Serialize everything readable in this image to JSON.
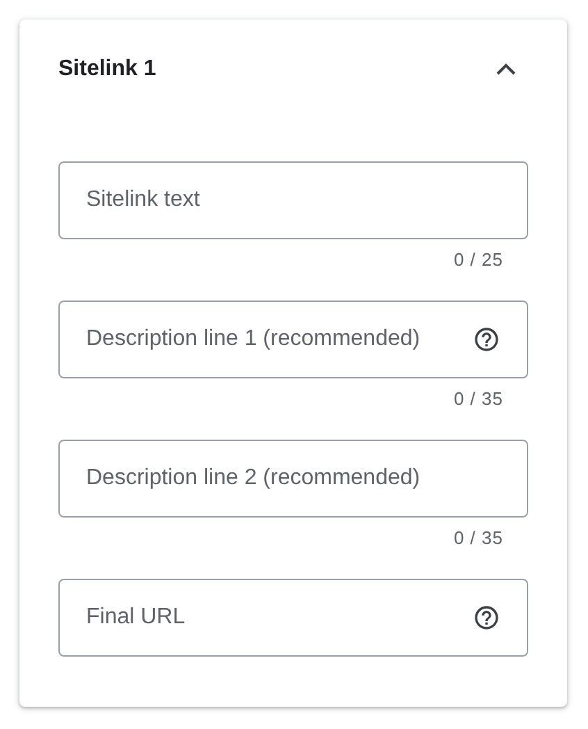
{
  "section": {
    "title": "Sitelink 1",
    "expanded": true
  },
  "fields": [
    {
      "placeholder": "Sitelink text",
      "counter": "0 / 25",
      "help": false
    },
    {
      "placeholder": "Description line 1 (recommended)",
      "counter": "0 / 35",
      "help": true
    },
    {
      "placeholder": "Description line 2 (recommended)",
      "counter": "0 / 35",
      "help": false
    },
    {
      "placeholder": "Final URL",
      "help": true
    }
  ]
}
